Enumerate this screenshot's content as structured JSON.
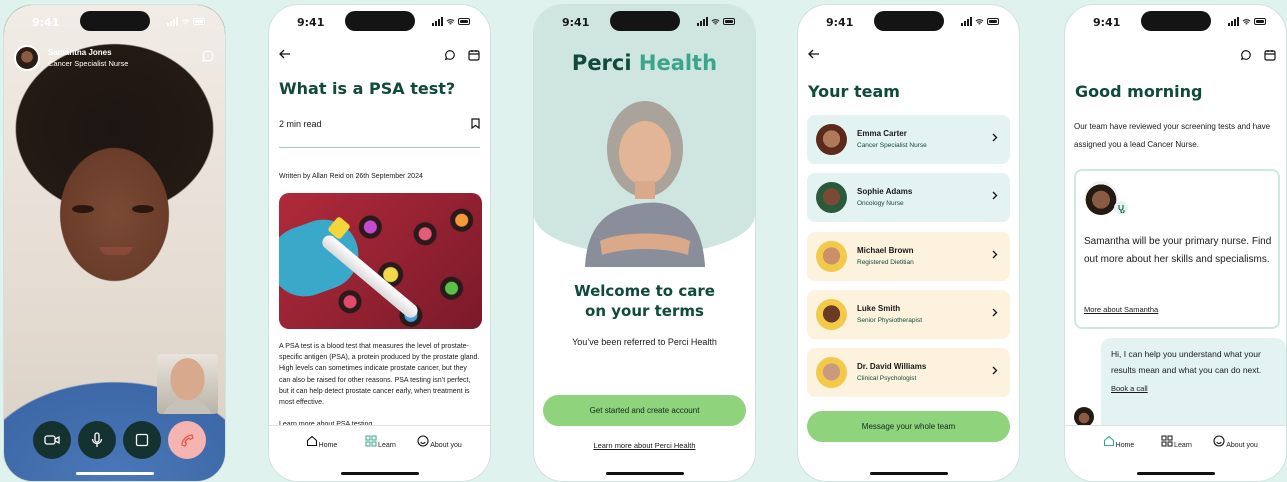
{
  "status": {
    "time": "9:41"
  },
  "call": {
    "name": "Samantha Jones",
    "role": "Cancer Specialist Nurse"
  },
  "article": {
    "title": "What is a PSA test?",
    "read_time": "2 min read",
    "byline": "Written by Allan Reid on 26th September 2024",
    "body": "A PSA test is a blood test that measures the level of prostate-specific antigen (PSA), a protein produced by the prostate gland. High levels can sometimes indicate prostate cancer, but they can also be raised for other reasons. PSA testing isn’t perfect, but it can help detect prostate cancer early, when treatment is most effective.",
    "learn_more": "Learn more about PSA testing"
  },
  "tabs": {
    "home": "Home",
    "learn": "Learn",
    "about": "About you"
  },
  "welcome": {
    "logo_a": "Perci",
    "logo_b": " Health",
    "headline_1": "Welcome to care",
    "headline_2": "on your terms",
    "referred": "You’ve been referred to Perci Health",
    "cta": "Get started and create account",
    "link": "Learn more about Perci Health"
  },
  "team": {
    "title": "Your team",
    "members": [
      {
        "name": "Emma Carter",
        "role": "Cancer Specialist Nurse"
      },
      {
        "name": "Sophie Adams",
        "role": "Oncology Nurse"
      },
      {
        "name": "Michael Brown",
        "role": "Registered Dietitian"
      },
      {
        "name": "Luke Smith",
        "role": "Senior Physiotherapist"
      },
      {
        "name": "Dr. David Williams",
        "role": "Clinical Psychologist"
      }
    ],
    "cta": "Message your whole team"
  },
  "home": {
    "greeting": "Good morning",
    "intro": "Our team have reviewed your screening tests and have assigned you a lead Cancer Nurse.",
    "nurse_text": "Samantha will be your primary nurse. Find out more about her skills and specialisms.",
    "nurse_link": "More about Samantha",
    "chat": "Hi, I can help you understand what your results mean and what you can do next.",
    "book": "Book a call"
  },
  "colors": {
    "brand_dark": "#0f4a3a",
    "brand_light": "#3aa58a",
    "button": "#8fd37d",
    "teal_card": "#e3f3f1",
    "cream_card": "#fdf2dd",
    "end_call": "#f5b4b1"
  }
}
